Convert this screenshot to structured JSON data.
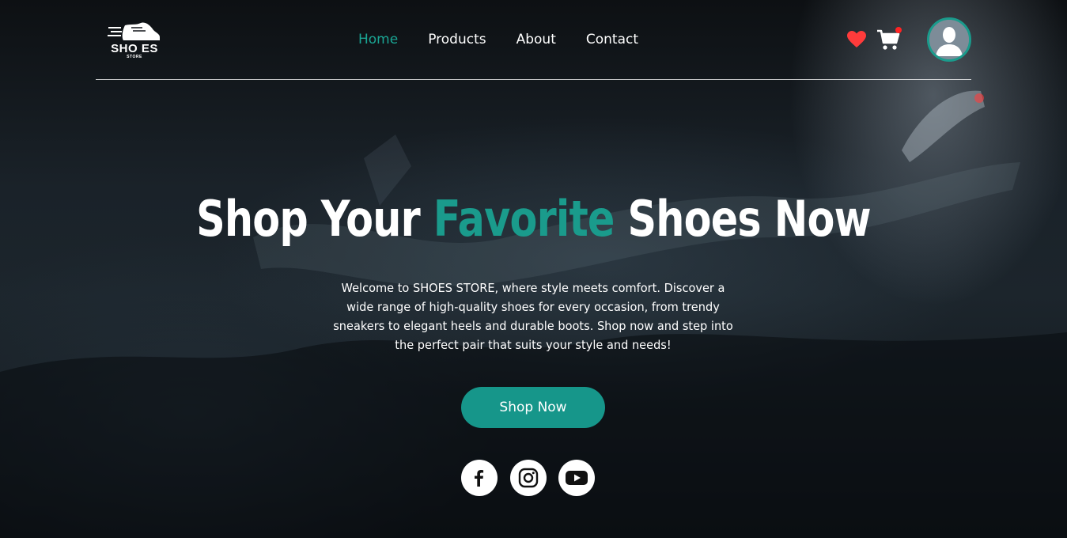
{
  "brand": {
    "logo_text": "SHO ES",
    "logo_sub": "STORE"
  },
  "nav": {
    "items": [
      {
        "label": "Home",
        "active": true
      },
      {
        "label": "Products",
        "active": false
      },
      {
        "label": "About",
        "active": false
      },
      {
        "label": "Contact",
        "active": false
      }
    ]
  },
  "header_icons": [
    "heart-icon",
    "cart-icon",
    "avatar"
  ],
  "hero": {
    "title_part1": "Shop Your ",
    "title_accent": "Favorite",
    "title_part2": " Shoes Now",
    "intro": "Welcome to SHOES STORE, where style meets comfort. Discover a wide range of high-quality shoes for every occasion, from trendy sneakers to elegant heels and durable boots. Shop now and step into the perfect pair that suits your style and needs!",
    "cta_label": "Shop Now"
  },
  "socials": [
    "facebook-icon",
    "instagram-icon",
    "youtube-icon"
  ],
  "colors": {
    "accent": "#1a9b8c",
    "button": "#16968a",
    "heart": "#ff3b3b",
    "cart_badge": "#ff2424"
  }
}
